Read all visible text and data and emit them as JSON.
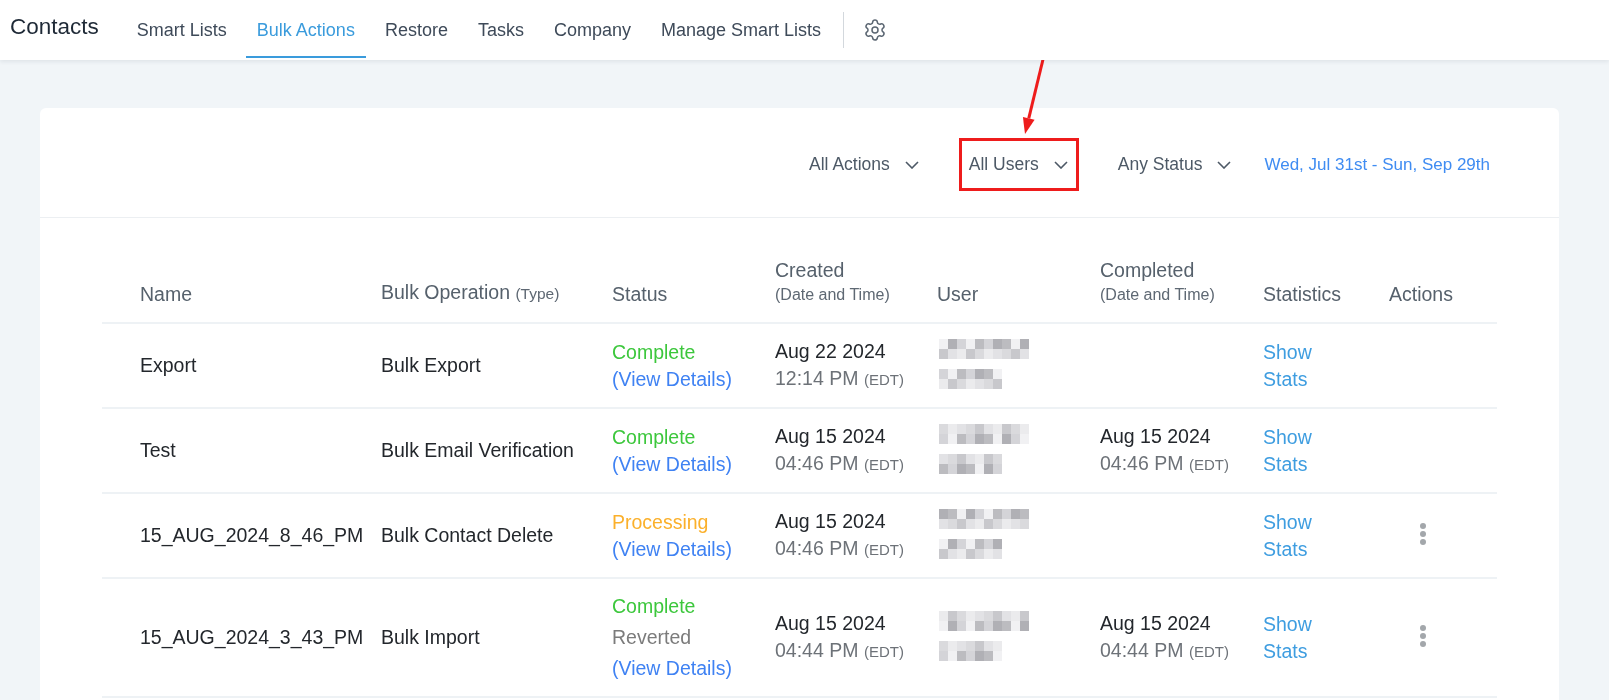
{
  "nav": {
    "title": "Contacts",
    "tabs": [
      {
        "label": "Smart Lists",
        "selected": false
      },
      {
        "label": "Bulk Actions",
        "selected": true
      },
      {
        "label": "Restore",
        "selected": false
      },
      {
        "label": "Tasks",
        "selected": false
      },
      {
        "label": "Company",
        "selected": false
      },
      {
        "label": "Manage Smart Lists",
        "selected": false
      }
    ]
  },
  "filters": [
    {
      "label": "All Actions",
      "highlighted": false
    },
    {
      "label": "All Users",
      "highlighted": true
    },
    {
      "label": "Any Status",
      "highlighted": false
    }
  ],
  "date_range": "Wed, Jul 31st - Sun, Sep 29th",
  "table": {
    "columns": [
      {
        "label": "Name",
        "kind": "plain"
      },
      {
        "label": "Bulk Operation",
        "note": "(Type)",
        "kind": "inline-note"
      },
      {
        "label": "Status",
        "kind": "plain"
      },
      {
        "label": "Created",
        "note": "(Date and Time)",
        "kind": "stacked-note"
      },
      {
        "label": "User",
        "kind": "plain"
      },
      {
        "label": "Completed",
        "note": "(Date and Time)",
        "kind": "stacked-note"
      },
      {
        "label": "Statistics",
        "kind": "plain"
      },
      {
        "label": "Actions",
        "kind": "plain"
      }
    ],
    "rows": [
      {
        "name": "Export",
        "operation": "Bulk Export",
        "status": [
          {
            "label": "Complete",
            "kind": "complete"
          }
        ],
        "details_link": "(View Details)",
        "created": {
          "date": "Aug 22 2024",
          "time": "12:14 PM",
          "zone": "(EDT)"
        },
        "stats_link": "Show Stats",
        "actions_menu": false
      },
      {
        "name": "Test",
        "operation": "Bulk Email Verification",
        "status": [
          {
            "label": "Complete",
            "kind": "complete"
          }
        ],
        "details_link": "(View Details)",
        "created": {
          "date": "Aug 15 2024",
          "time": "04:46 PM",
          "zone": "(EDT)"
        },
        "completed": {
          "date": "Aug 15 2024",
          "time": "04:46 PM",
          "zone": "(EDT)"
        },
        "stats_link": "Show Stats",
        "actions_menu": false
      },
      {
        "name": "15_AUG_2024_8_46_PM",
        "operation": "Bulk Contact Delete",
        "status": [
          {
            "label": "Processing",
            "kind": "processing"
          }
        ],
        "details_link": "(View Details)",
        "created": {
          "date": "Aug 15 2024",
          "time": "04:46 PM",
          "zone": "(EDT)"
        },
        "stats_link": "Show Stats",
        "actions_menu": true
      },
      {
        "name": "15_AUG_2024_3_43_PM",
        "operation": "Bulk Import",
        "status": [
          {
            "label": "Complete",
            "kind": "complete"
          },
          {
            "label": "Reverted",
            "kind": "reverted"
          }
        ],
        "details_link": "(View Details)",
        "created": {
          "date": "Aug 15 2024",
          "time": "04:44 PM",
          "zone": "(EDT)"
        },
        "completed": {
          "date": "Aug 15 2024",
          "time": "04:44 PM",
          "zone": "(EDT)"
        },
        "stats_link": "Show Stats",
        "actions_menu": true
      }
    ]
  }
}
